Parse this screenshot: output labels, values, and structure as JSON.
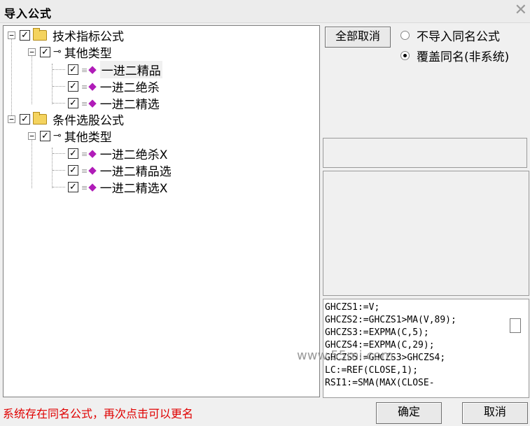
{
  "window": {
    "title": "导入公式"
  },
  "tree": {
    "group1": {
      "label": "技术指标公式",
      "sub": "其他类型",
      "items": [
        "一进二精品",
        "一进二绝杀",
        "一进二精选"
      ]
    },
    "group2": {
      "label": "条件选股公式",
      "sub": "其他类型",
      "items": [
        "一进二绝杀X",
        "一进二精品选",
        "一进二精选X"
      ]
    }
  },
  "options": {
    "cancel_all": "全部取消",
    "radio1": "不导入同名公式",
    "radio2": "覆盖同名(非系统)",
    "selected": "覆盖同名(非系统)"
  },
  "code_lines": [
    "GHCZS1:=V;",
    "GHCZS2:=GHCZS1>MA(V,89);",
    "GHCZS3:=EXPMA(C,5);",
    "GHCZS4:=EXPMA(C,29);",
    "GHCZS5:=GHCZS3>GHCZS4;",
    "LC:=REF(CLOSE,1);",
    "RSI1:=SMA(MAX(CLOSE-"
  ],
  "watermark": "www.55mi.com",
  "status": "系统存在同名公式，再次点击可以更名",
  "buttons": {
    "ok": "确定",
    "cancel": "取消"
  },
  "colors": {
    "status": "#e00000",
    "checkbox_check": "#000000",
    "gem": "#b01cb8"
  }
}
